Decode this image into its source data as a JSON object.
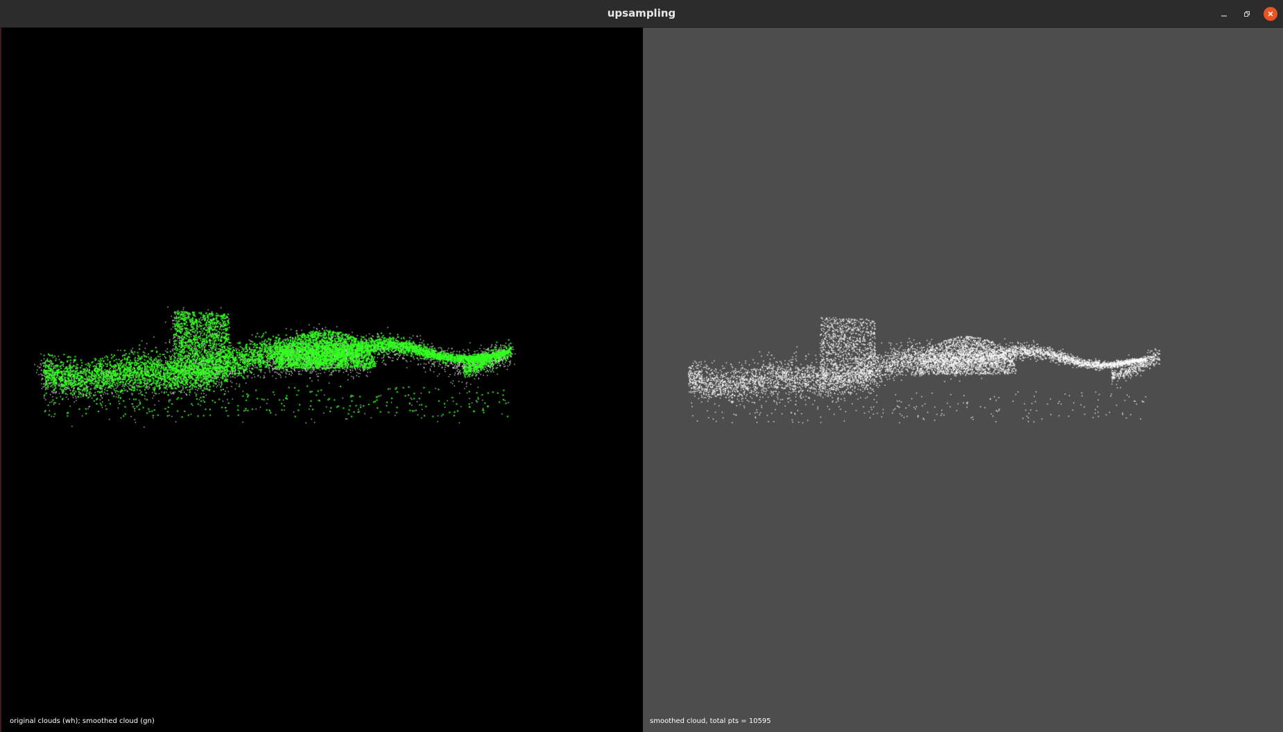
{
  "window": {
    "title": "upsampling",
    "controls": {
      "minimize_icon": "minimize-icon",
      "maximize_icon": "restore-icon",
      "close_icon": "close-icon"
    }
  },
  "viewports": {
    "left": {
      "label": "original clouds (wh); smoothed cloud (gn)",
      "background": "#000000",
      "original_cloud_color": "#ffffff",
      "smoothed_cloud_color": "#33ff1f"
    },
    "right": {
      "label": "smoothed cloud, total pts = 10595",
      "background": "#4d4d4d",
      "cloud_color": "#ffffff"
    }
  },
  "colors": {
    "titlebar": "#2c2c2c",
    "close_button": "#e95420"
  }
}
